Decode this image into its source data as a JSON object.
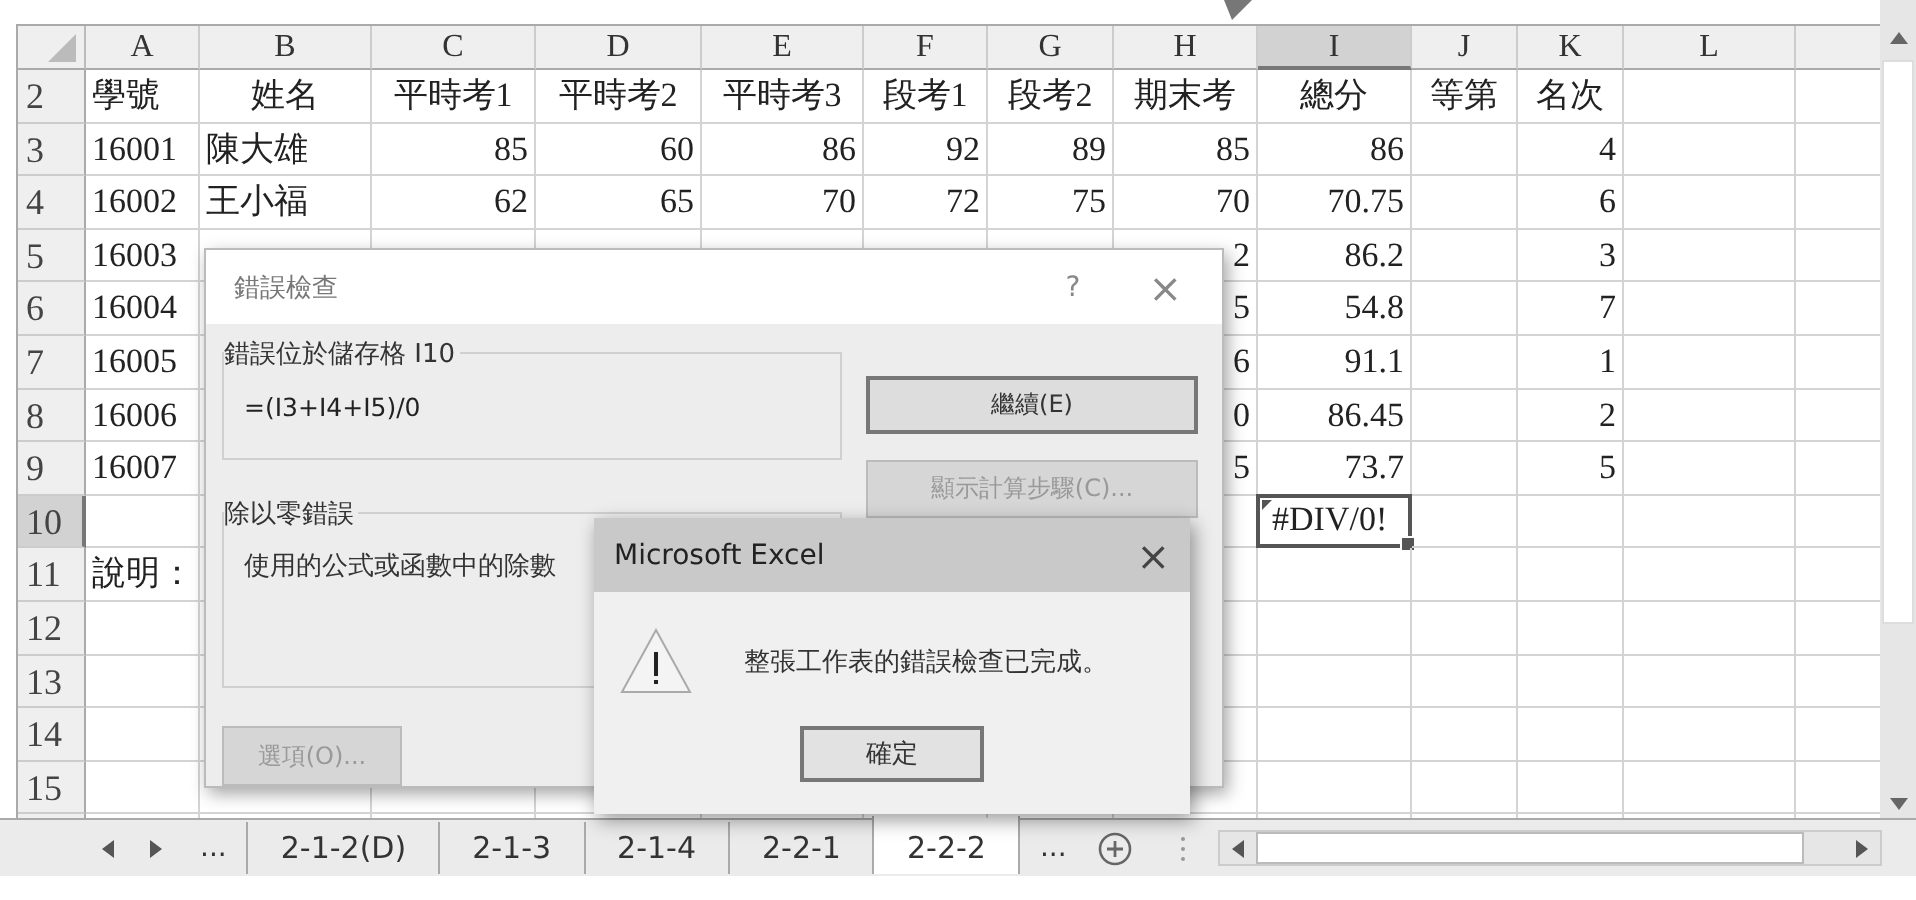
{
  "columns": [
    {
      "label": "A",
      "selected": false
    },
    {
      "label": "B",
      "selected": false
    },
    {
      "label": "C",
      "selected": false
    },
    {
      "label": "D",
      "selected": false
    },
    {
      "label": "E",
      "selected": false
    },
    {
      "label": "F",
      "selected": false
    },
    {
      "label": "G",
      "selected": false
    },
    {
      "label": "H",
      "selected": false
    },
    {
      "label": "I",
      "selected": true
    },
    {
      "label": "J",
      "selected": false
    },
    {
      "label": "K",
      "selected": false
    },
    {
      "label": "L",
      "selected": false
    }
  ],
  "rows": [
    {
      "number": "2",
      "selected": false,
      "kind": "header",
      "cells": [
        "學號",
        "姓名",
        "平時考1",
        "平時考2",
        "平時考3",
        "段考1",
        "段考2",
        "期末考",
        "總分",
        "等第",
        "名次"
      ]
    },
    {
      "number": "3",
      "selected": false,
      "kind": "data",
      "cells": [
        "16001",
        "陳大雄",
        "85",
        "60",
        "86",
        "92",
        "89",
        "85",
        "86",
        null,
        "4"
      ]
    },
    {
      "number": "4",
      "selected": false,
      "kind": "data",
      "cells": [
        "16002",
        "王小福",
        "62",
        "65",
        "70",
        "72",
        "75",
        "70",
        "70.75",
        null,
        "6"
      ]
    },
    {
      "number": "5",
      "selected": false,
      "kind": "data",
      "cells": [
        "16003",
        null,
        null,
        null,
        null,
        null,
        null,
        "2",
        "86.2",
        null,
        "3"
      ]
    },
    {
      "number": "6",
      "selected": false,
      "kind": "data",
      "cells": [
        "16004",
        null,
        null,
        null,
        null,
        null,
        null,
        "5",
        "54.8",
        null,
        "7"
      ]
    },
    {
      "number": "7",
      "selected": false,
      "kind": "data",
      "cells": [
        "16005",
        null,
        null,
        null,
        null,
        null,
        null,
        "6",
        "91.1",
        null,
        "1"
      ]
    },
    {
      "number": "8",
      "selected": false,
      "kind": "data",
      "cells": [
        "16006",
        null,
        null,
        null,
        null,
        null,
        null,
        "0",
        "86.45",
        null,
        "2"
      ]
    },
    {
      "number": "9",
      "selected": false,
      "kind": "data",
      "cells": [
        "16007",
        null,
        null,
        null,
        null,
        null,
        null,
        "5",
        "73.7",
        null,
        "5"
      ]
    },
    {
      "number": "10",
      "selected": true,
      "kind": "data",
      "cells": [
        null,
        null,
        null,
        null,
        null,
        null,
        null,
        null,
        {
          "text": "#DIV/0!",
          "error": true
        }
      ]
    },
    {
      "number": "11",
      "selected": false,
      "kind": "data",
      "cells": [
        "說明："
      ]
    },
    {
      "number": "12",
      "selected": false,
      "kind": "data"
    },
    {
      "number": "13",
      "selected": false,
      "kind": "data"
    },
    {
      "number": "14",
      "selected": false,
      "kind": "data"
    },
    {
      "number": "15",
      "selected": false,
      "kind": "data"
    }
  ],
  "error_dialog": {
    "title": "錯誤檢查",
    "help": "?",
    "close": "×",
    "location_group": {
      "label": "錯誤位於儲存格 I10",
      "formula": "=(I3+I4+I5)/0"
    },
    "error_group": {
      "label": "除以零錯誤",
      "description": "使用的公式或函數中的除數"
    },
    "buttons": [
      {
        "label": "繼續(E)",
        "disabled": false
      },
      {
        "label": "顯示計算步驟(C)...",
        "disabled": true
      }
    ],
    "options_button": {
      "label": "選項(O)...",
      "disabled": true
    }
  },
  "message_box": {
    "title": "Microsoft Excel",
    "close": "×",
    "message": "整張工作表的錯誤檢查已完成。",
    "button": "確定"
  },
  "sheet_tabs": {
    "overflow_left": "...",
    "tabs": [
      {
        "label": "2-1-2(D)",
        "selected": false
      },
      {
        "label": "2-1-3",
        "selected": false
      },
      {
        "label": "2-1-4",
        "selected": false
      },
      {
        "label": "2-2-1",
        "selected": false
      },
      {
        "label": "2-2-2",
        "selected": true
      }
    ],
    "overflow_right": "..."
  }
}
